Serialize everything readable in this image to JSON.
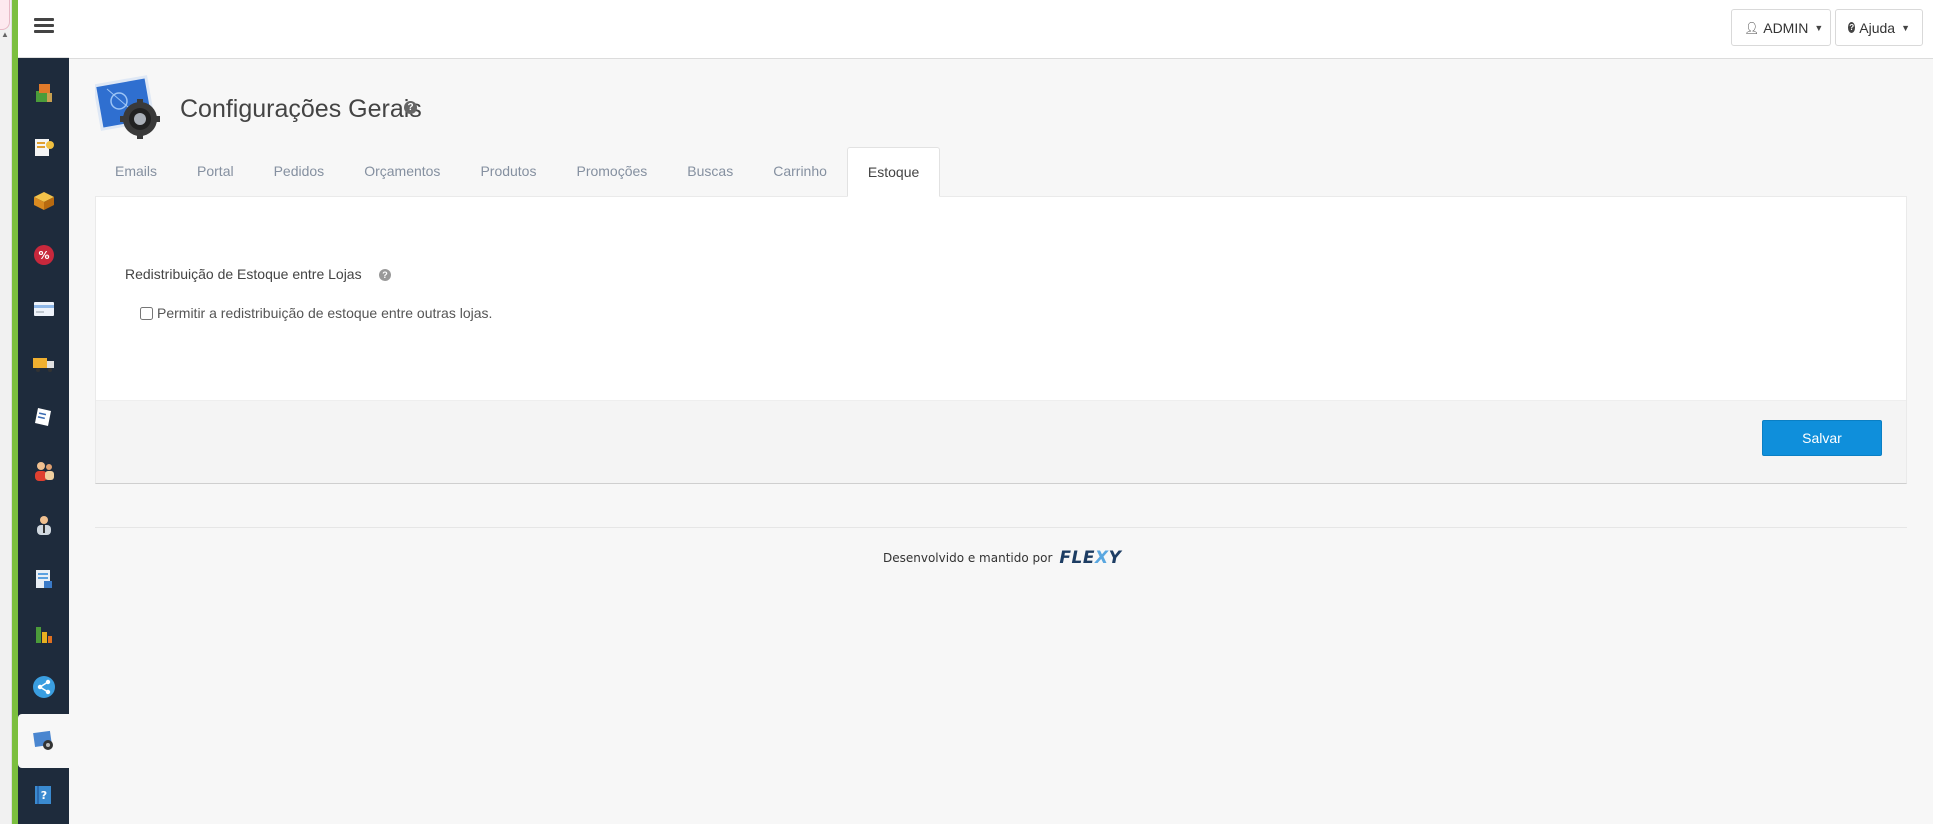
{
  "topbar": {
    "user_label": "ADMIN",
    "help_label": "Ajuda"
  },
  "sidebar": {
    "items": [
      {
        "name": "products",
        "icon": "boxes-icon",
        "color": "#4b9c3a"
      },
      {
        "name": "catalog",
        "icon": "catalog-icon",
        "color": "#e0a030"
      },
      {
        "name": "orders",
        "icon": "box-icon",
        "color": "#e09a2e"
      },
      {
        "name": "promotions",
        "icon": "percent-icon",
        "color": "#c8283c"
      },
      {
        "name": "payments",
        "icon": "card-icon",
        "color": "#8fb8e8"
      },
      {
        "name": "shipping",
        "icon": "truck-icon",
        "color": "#f0b030"
      },
      {
        "name": "documents",
        "icon": "document-icon",
        "color": "#ffffff"
      },
      {
        "name": "customers",
        "icon": "users-icon",
        "color": "#e04030"
      },
      {
        "name": "sellers",
        "icon": "user-icon",
        "color": "#d0d8e0"
      },
      {
        "name": "reports",
        "icon": "report-icon",
        "color": "#5aa0e0"
      },
      {
        "name": "statistics",
        "icon": "bar-chart-icon",
        "color": "#e8b020"
      },
      {
        "name": "integrations",
        "icon": "share-icon",
        "color": "#3a9ee0"
      },
      {
        "name": "settings",
        "icon": "settings-icon",
        "color": "#3a7ac8",
        "active": true
      },
      {
        "name": "help",
        "icon": "help-book-icon",
        "color": "#3a8ad0"
      }
    ]
  },
  "page": {
    "title": "Configurações Gerais"
  },
  "tabs": [
    {
      "label": "Emails"
    },
    {
      "label": "Portal"
    },
    {
      "label": "Pedidos"
    },
    {
      "label": "Orçamentos"
    },
    {
      "label": "Produtos"
    },
    {
      "label": "Promoções"
    },
    {
      "label": "Buscas"
    },
    {
      "label": "Carrinho"
    },
    {
      "label": "Estoque",
      "active": true
    }
  ],
  "form": {
    "field_label": "Redistribuição de Estoque entre Lojas",
    "checkbox_label": "Permitir a redistribuição de estoque entre outras lojas.",
    "checkbox_checked": false,
    "save_label": "Salvar"
  },
  "footer": {
    "text": "Desenvolvido e mantido por",
    "brand_start": "FLE",
    "brand_x": "X",
    "brand_end": "Y"
  },
  "colors": {
    "sidebar_bg": "#1e2b3c",
    "accent": "#0f8fdb",
    "green_strip": "#7bbf3f"
  }
}
